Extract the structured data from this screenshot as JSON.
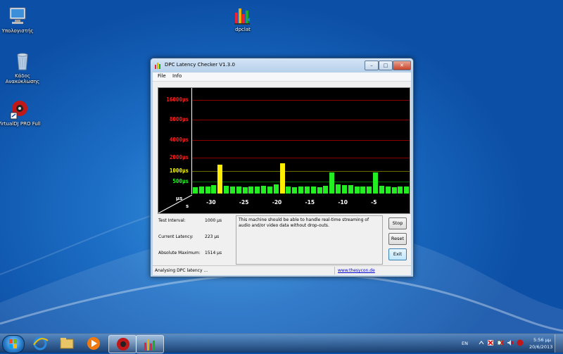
{
  "desktop": {
    "icons": [
      {
        "label": "Υπολογιστής"
      },
      {
        "label": "Κάδος Ανακύκλωσης"
      },
      {
        "label": "VirtualDJ PRO Full"
      },
      {
        "label": "dpclat"
      }
    ]
  },
  "window": {
    "title": "DPC Latency Checker V1.3.0",
    "menu": [
      "File",
      "Info"
    ],
    "controls": {
      "minimize": "–",
      "maximize": "□",
      "close": "✕"
    }
  },
  "chart_data": {
    "type": "bar",
    "ylabels": [
      {
        "text": "16000µs",
        "color": "#ff2020"
      },
      {
        "text": "8000µs",
        "color": "#ff2020"
      },
      {
        "text": "4000µs",
        "color": "#ff2020"
      },
      {
        "text": "2000µs",
        "color": "#ff2020"
      },
      {
        "text": "1000µs",
        "color": "#ffff00"
      },
      {
        "text": "500µs",
        "color": "#22ff22"
      }
    ],
    "gridlines": [
      16000,
      8000,
      4000,
      2000,
      1000,
      500
    ],
    "x_tick_labels": [
      "-30",
      "-25",
      "-20",
      "-15",
      "-10",
      "-5"
    ],
    "xlim": [
      -33,
      0
    ],
    "units": {
      "y": "µs",
      "x": "s"
    },
    "x": [
      -33,
      -32,
      -31,
      -30,
      -29,
      -28,
      -27,
      -26,
      -25,
      -24,
      -23,
      -22,
      -21,
      -20,
      -19,
      -18,
      -17,
      -16,
      -15,
      -14,
      -13,
      -12,
      -11,
      -10,
      -9,
      -8,
      -7,
      -6,
      -5,
      -4,
      -3,
      -2,
      -1
    ],
    "values": [
      160,
      190,
      200,
      260,
      1400,
      230,
      190,
      200,
      170,
      190,
      200,
      230,
      190,
      290,
      1514,
      190,
      180,
      200,
      190,
      190,
      180,
      220,
      900,
      300,
      260,
      240,
      200,
      190,
      200,
      900,
      230,
      190,
      180,
      200,
      200
    ],
    "thresholds": {
      "yellow": 1000,
      "red": 2000
    },
    "colors": {
      "green": "#22ee22",
      "yellow": "#ffee00",
      "red": "#ff2020",
      "grid_red": "#8b0000",
      "grid_yellow": "#6b6b00",
      "grid_green": "#006b00"
    }
  },
  "info": {
    "test_interval_label": "Test Interval:",
    "test_interval_value": "1000 µs",
    "current_latency_label": "Current Latency:",
    "current_latency_value": "223 µs",
    "absolute_maximum_label": "Absolute Maximum:",
    "absolute_maximum_value": "1514 µs",
    "message": "This machine should be able to handle real-time streaming of audio and/or video data without drop-outs."
  },
  "buttons": {
    "stop": "Stop",
    "reset": "Reset",
    "exit": "Exit"
  },
  "status": {
    "text": "Analysing DPC latency ...",
    "link": "www.thesycon.de"
  },
  "taskbar": {
    "language": "EN",
    "time": "5:56 μμ",
    "date": "20/6/2013"
  }
}
